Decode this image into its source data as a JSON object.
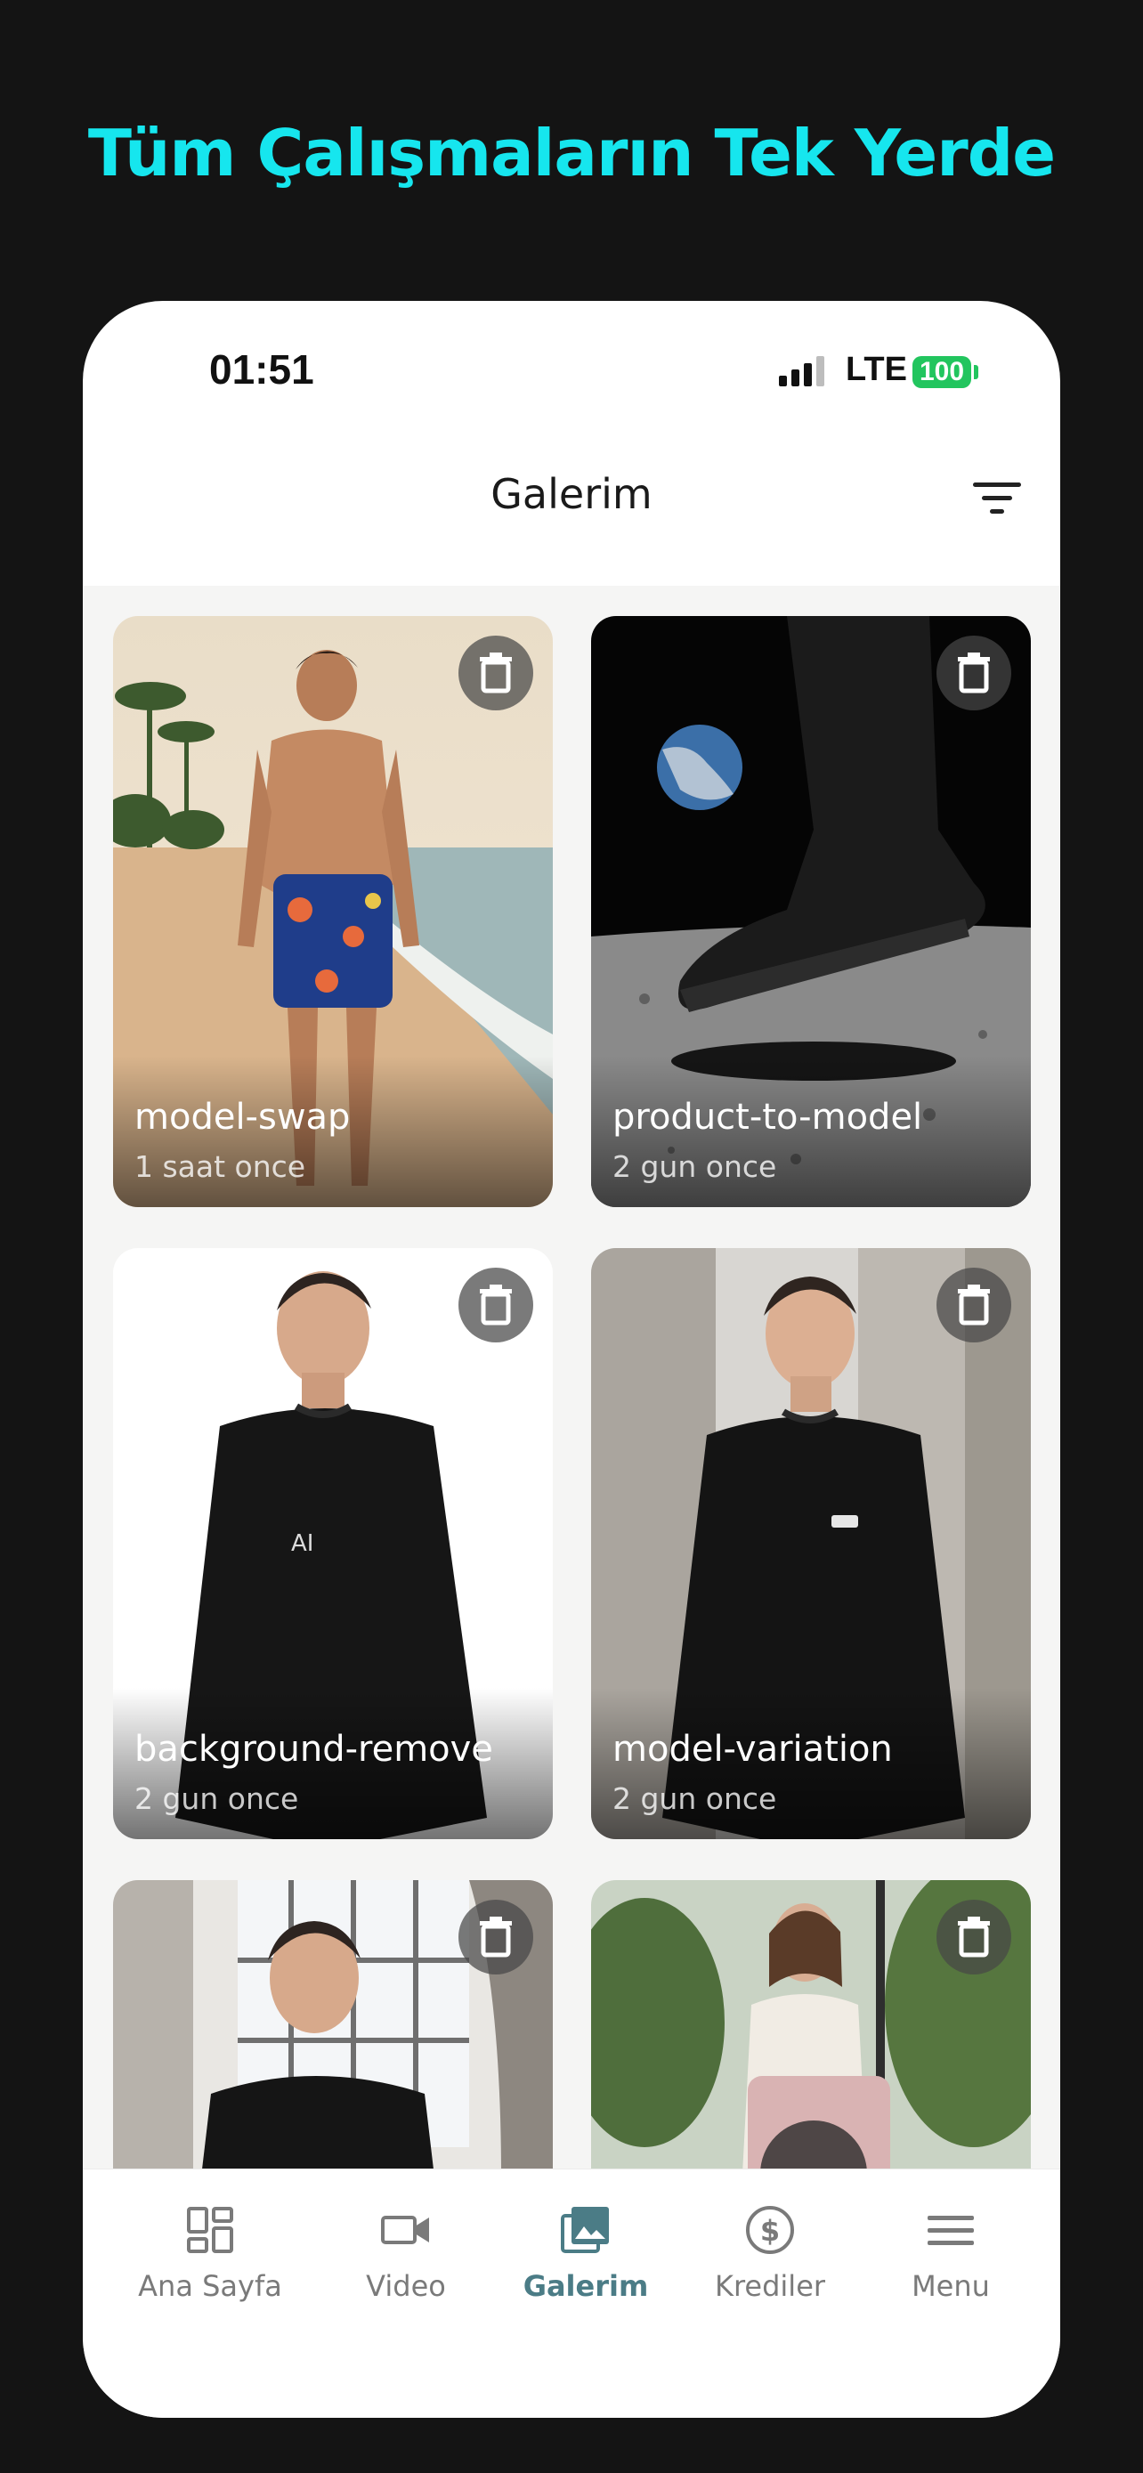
{
  "headline": "Tüm Çalışmaların Tek Yerde",
  "status_bar": {
    "time": "01:51",
    "network": "LTE",
    "battery": "100"
  },
  "header": {
    "title": "Galerim",
    "filter_icon": "filter-icon"
  },
  "gallery": {
    "items": [
      {
        "name": "model-swap",
        "time": "1 saat once"
      },
      {
        "name": "product-to-model",
        "time": "2 gun once"
      },
      {
        "name": "background-remove",
        "time": "2 gun once"
      },
      {
        "name": "model-variation",
        "time": "2 gun once"
      },
      {
        "name": "",
        "time": ""
      },
      {
        "name": "",
        "time": ""
      }
    ],
    "delete_icon": "trash-icon"
  },
  "tabbar": {
    "tabs": [
      {
        "label": "Ana Sayfa",
        "icon": "dashboard-icon"
      },
      {
        "label": "Video",
        "icon": "video-camera-icon"
      },
      {
        "label": "Galerim",
        "icon": "gallery-icon"
      },
      {
        "label": "Krediler",
        "icon": "dollar-coin-icon"
      },
      {
        "label": "Menu",
        "icon": "menu-icon"
      }
    ],
    "active_index": 2
  },
  "colors": {
    "accent": "#16e6ee",
    "active_tab": "#4b7c86",
    "battery": "#22c55e"
  }
}
